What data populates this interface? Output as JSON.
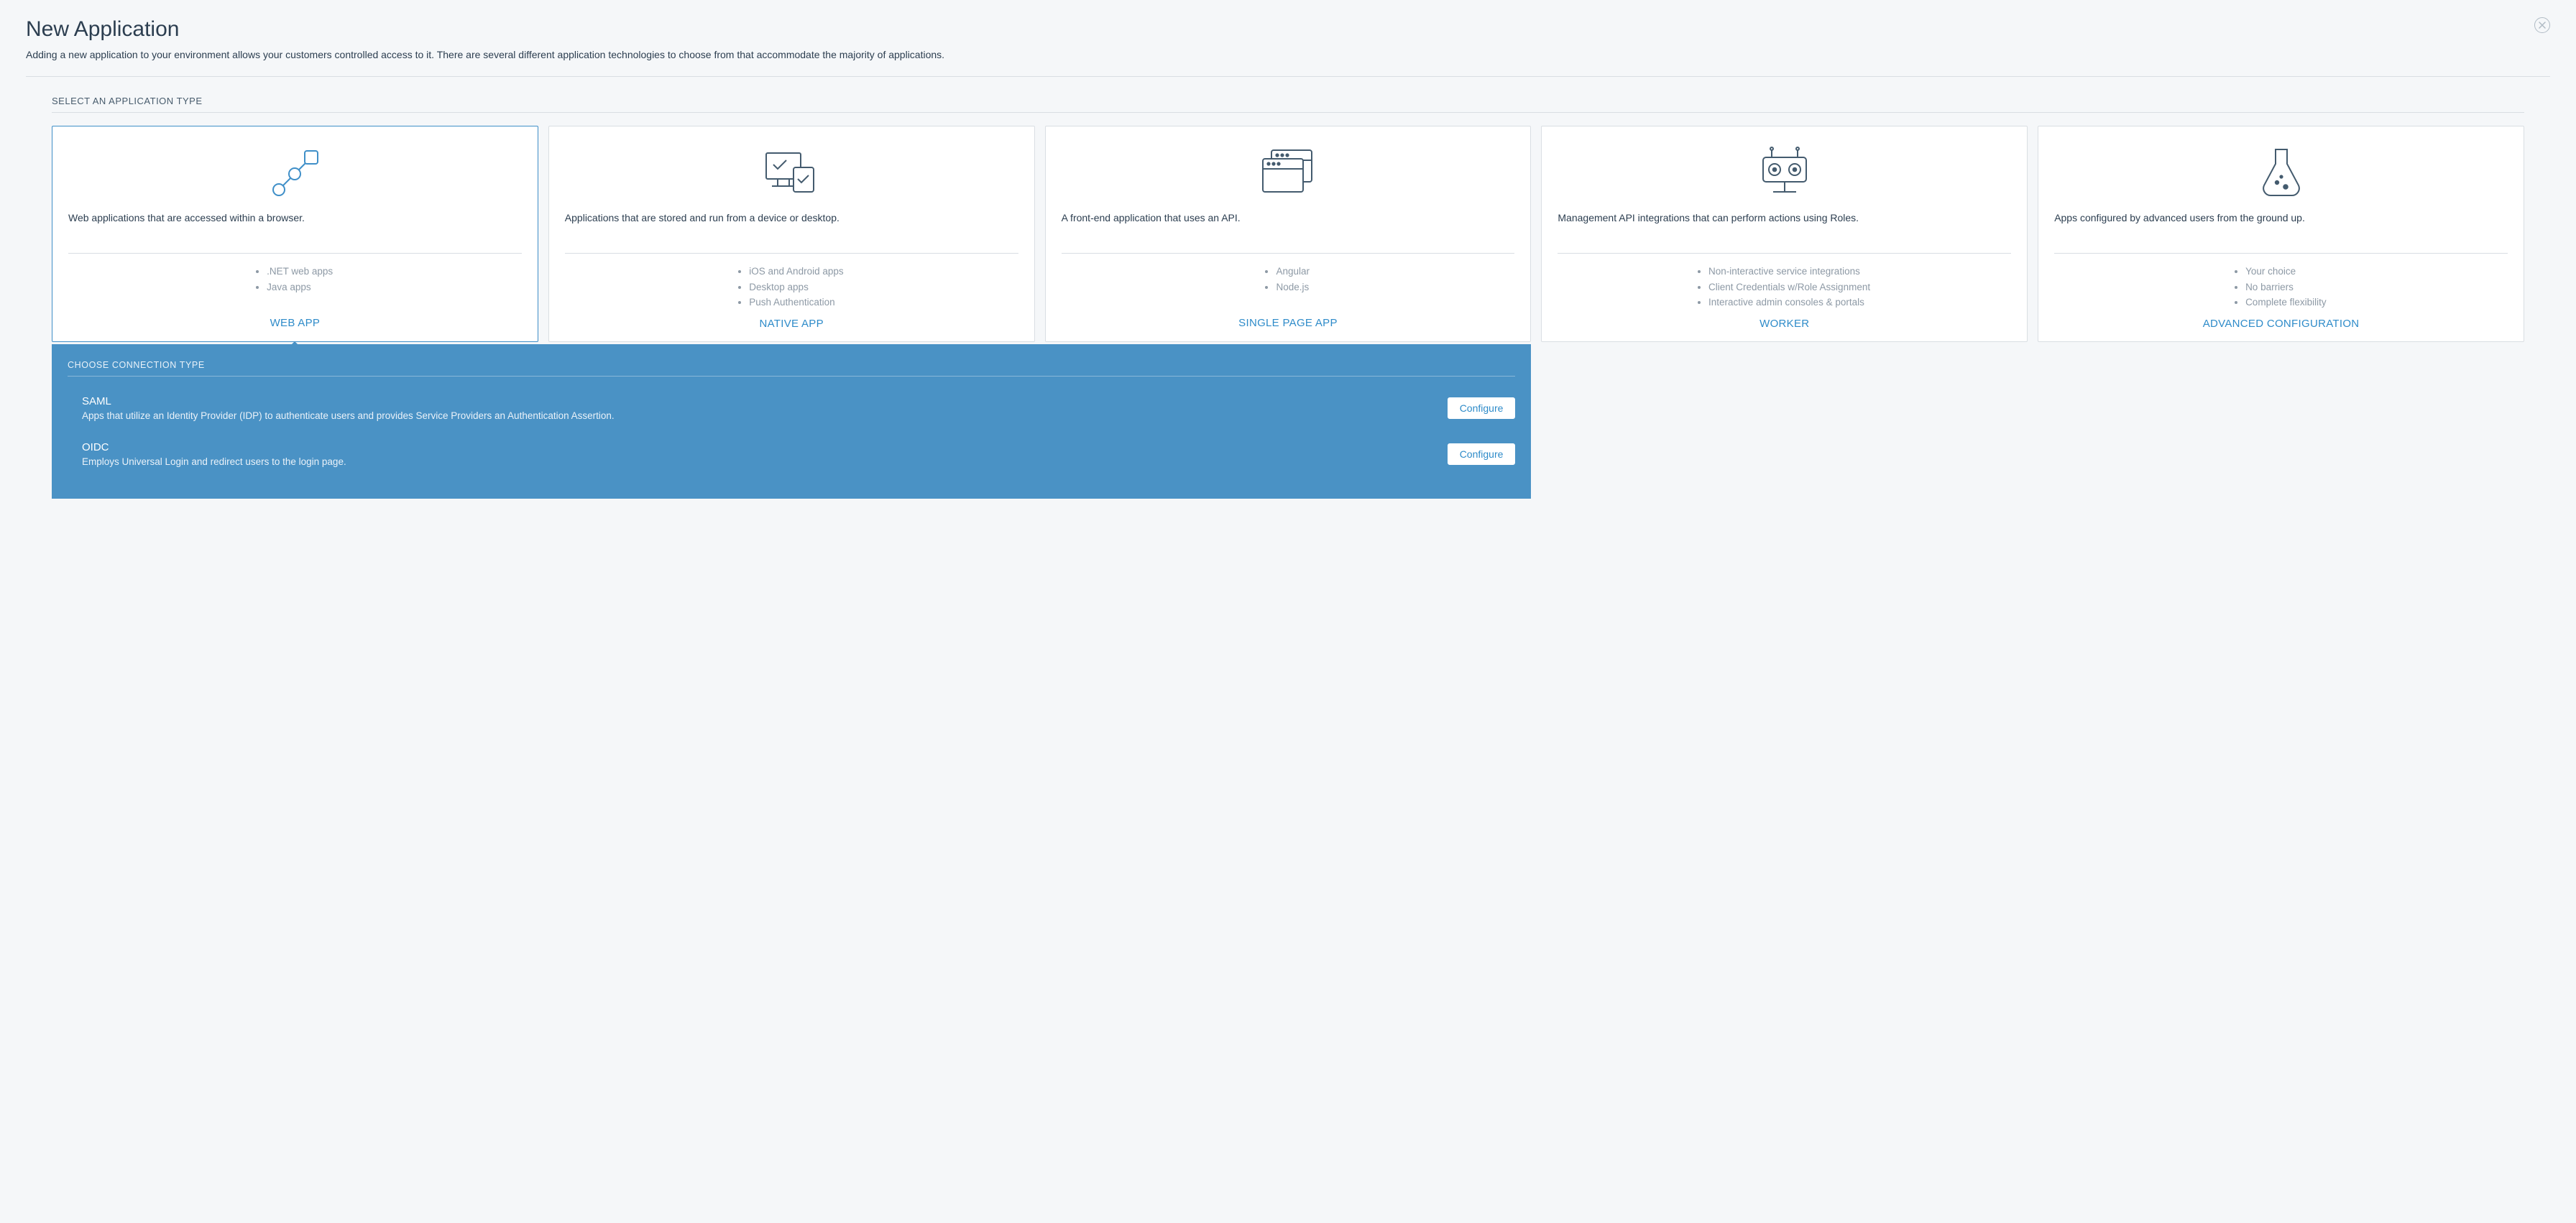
{
  "header": {
    "title": "New Application",
    "subtitle": "Adding a new application to your environment allows your customers controlled access to it. There are several different application technologies to choose from that accommodate the majority of applications."
  },
  "section_label": "SELECT AN APPLICATION TYPE",
  "cards": [
    {
      "desc": "Web applications that are accessed within a browser.",
      "bullets": [
        ".NET web apps",
        "Java apps"
      ],
      "cta": "WEB APP"
    },
    {
      "desc": "Applications that are stored and run from a device or desktop.",
      "bullets": [
        "iOS and Android apps",
        "Desktop apps",
        "Push Authentication"
      ],
      "cta": "NATIVE APP"
    },
    {
      "desc": "A front-end application that uses an API.",
      "bullets": [
        "Angular",
        "Node.js"
      ],
      "cta": "SINGLE PAGE APP"
    },
    {
      "desc": "Management API integrations that can perform actions using Roles.",
      "bullets": [
        "Non-interactive service integrations",
        "Client Credentials w/Role Assignment",
        "Interactive admin consoles & portals"
      ],
      "cta": "WORKER"
    },
    {
      "desc": "Apps configured by advanced users from the ground up.",
      "bullets": [
        "Your choice",
        "No barriers",
        "Complete flexibility"
      ],
      "cta": "ADVANCED CONFIGURATION"
    }
  ],
  "connection_panel": {
    "label": "CHOOSE CONNECTION TYPE",
    "items": [
      {
        "name": "SAML",
        "desc": "Apps that utilize an Identity Provider (IDP) to authenticate users and provides Service Providers an Authentication Assertion.",
        "button": "Configure"
      },
      {
        "name": "OIDC",
        "desc": "Employs Universal Login and redirect users to the login page.",
        "button": "Configure"
      }
    ]
  }
}
